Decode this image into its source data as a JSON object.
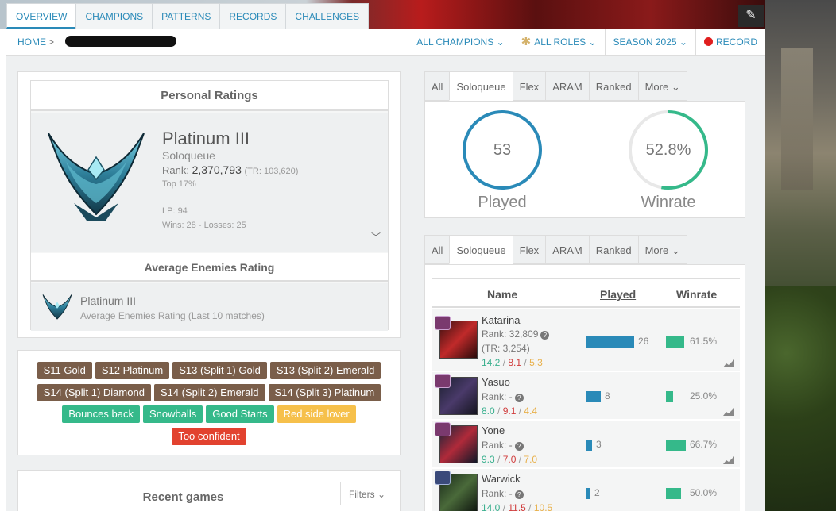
{
  "nav": {
    "tabs": [
      "OVERVIEW",
      "CHAMPIONS",
      "PATTERNS",
      "RECORDS",
      "CHALLENGES"
    ],
    "active_tab": "OVERVIEW"
  },
  "breadcrumb": {
    "home": "HOME",
    "separator": ">"
  },
  "filters": {
    "champions": "ALL CHAMPIONS",
    "roles": "ALL ROLES",
    "season": "SEASON 2025",
    "record": "RECORD"
  },
  "personal_ratings": {
    "title": "Personal Ratings",
    "tier": "Platinum III",
    "queue": "Soloqueue",
    "rank_label": "Rank:",
    "rank_value": "2,370,793",
    "tr": "(TR: 103,620)",
    "top": "Top 17%",
    "lp": "LP: 94",
    "wins_losses": "Wins: 28 - Losses: 25"
  },
  "average_enemies": {
    "title": "Average Enemies Rating",
    "tier": "Platinum III",
    "subtitle": "Average Enemies Rating (Last 10 matches)"
  },
  "tags": {
    "row1": [
      "S11 Gold",
      "S12 Platinum",
      "S13 (Split 1) Gold",
      "S13 (Split 2) Emerald"
    ],
    "row2": [
      "S14 (Split 1) Diamond",
      "S14 (Split 2) Emerald",
      "S14 (Split 3) Platinum"
    ],
    "row3": [
      "Bounces back",
      "Snowballs",
      "Good Starts",
      "Red side lover"
    ],
    "row4": [
      "Too confident"
    ]
  },
  "recent_games": {
    "title": "Recent games",
    "filters": "Filters"
  },
  "queue_tabs": [
    "All",
    "Soloqueue",
    "Flex",
    "ARAM",
    "Ranked",
    "More"
  ],
  "queue_active": "Soloqueue",
  "stats": {
    "played_value": "53",
    "played_label": "Played",
    "winrate_value": "52.8%",
    "winrate_label": "Winrate",
    "winrate_fraction": 0.528
  },
  "champion_table": {
    "headers": {
      "name": "Name",
      "played": "Played",
      "winrate": "Winrate"
    },
    "rows": [
      {
        "name": "Katarina",
        "rank": "Rank: 32,809",
        "tr": "(TR: 3,254)",
        "kills": "14.2",
        "deaths": "8.1",
        "assists": "5.3",
        "played": "26",
        "winrate": "61.5%"
      },
      {
        "name": "Yasuo",
        "rank": "Rank: -",
        "tr": "",
        "kills": "8.0",
        "deaths": "9.1",
        "assists": "4.4",
        "played": "8",
        "winrate": "25.0%"
      },
      {
        "name": "Yone",
        "rank": "Rank: -",
        "tr": "",
        "kills": "9.3",
        "deaths": "7.0",
        "assists": "7.0",
        "played": "3",
        "winrate": "66.7%"
      },
      {
        "name": "Warwick",
        "rank": "Rank: -",
        "tr": "",
        "kills": "14.0",
        "deaths": "11.5",
        "assists": "10.5",
        "played": "2",
        "winrate": "50.0%"
      }
    ]
  },
  "colors": {
    "accent": "#2a8ab8",
    "win_green": "#35b98a",
    "tag_brown": "#7a5e4a",
    "tag_yellow": "#f6c04b",
    "tag_red": "#e2422f"
  }
}
